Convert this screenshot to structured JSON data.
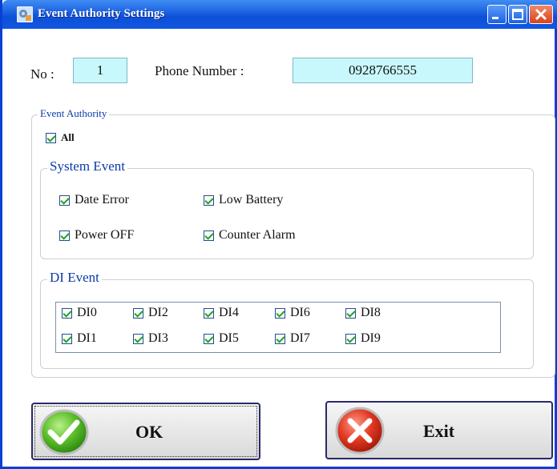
{
  "window": {
    "title": "Event Authority Settings",
    "icons": {
      "app": "settings-app-icon",
      "minimize": "minimize-icon",
      "maximize": "maximize-icon",
      "close": "close-icon"
    }
  },
  "header": {
    "no_label": "No :",
    "no_value": "1",
    "phone_label": "Phone Number :",
    "phone_value": "0928766555"
  },
  "event_authority": {
    "legend": "Event Authority",
    "all_label": "All",
    "all_checked": true
  },
  "system_event": {
    "legend": "System Event",
    "items": [
      {
        "label": "Date Error",
        "checked": true
      },
      {
        "label": "Low Battery",
        "checked": true
      },
      {
        "label": "Power OFF",
        "checked": true
      },
      {
        "label": "Counter Alarm",
        "checked": true
      }
    ]
  },
  "di_event": {
    "legend": "DI Event",
    "items": [
      {
        "label": "DI0",
        "checked": true
      },
      {
        "label": "DI2",
        "checked": true
      },
      {
        "label": "DI4",
        "checked": true
      },
      {
        "label": "DI6",
        "checked": true
      },
      {
        "label": "DI8",
        "checked": true
      },
      {
        "label": "DI1",
        "checked": true
      },
      {
        "label": "DI3",
        "checked": true
      },
      {
        "label": "DI5",
        "checked": true
      },
      {
        "label": "DI7",
        "checked": true
      },
      {
        "label": "DI9",
        "checked": true
      }
    ]
  },
  "buttons": {
    "ok_label": "OK",
    "ok_icon": "green-check-icon",
    "exit_label": "Exit",
    "exit_icon": "red-x-icon"
  },
  "colors": {
    "titlebar": "#1a5fe0",
    "field_bg": "#c8f8fb",
    "legend_text": "#0b3aa8",
    "check": "#21a121"
  }
}
